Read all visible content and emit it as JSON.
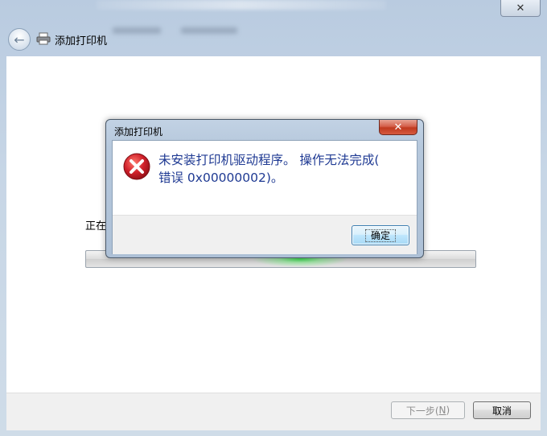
{
  "window": {
    "close_glyph": "✕"
  },
  "wizard": {
    "title": "添加打印机",
    "status_text": "正在",
    "progress_fraction": 0.55,
    "buttons": {
      "next": {
        "label": "下一步(",
        "key": "N",
        "suffix": ")",
        "enabled": false
      },
      "cancel": {
        "label": "取消"
      }
    }
  },
  "dialog": {
    "title": "添加打印机",
    "close_glyph": "✕",
    "icon": "error-icon",
    "message_line1": "未安装打印机驱动程序。 操作无法完成(",
    "message_line2": "错误 0x00000002)。",
    "ok_label": "确定"
  },
  "colors": {
    "message_text": "#1f3a93",
    "error_red": "#d0202a",
    "progress_glow": "#3cdc50"
  }
}
